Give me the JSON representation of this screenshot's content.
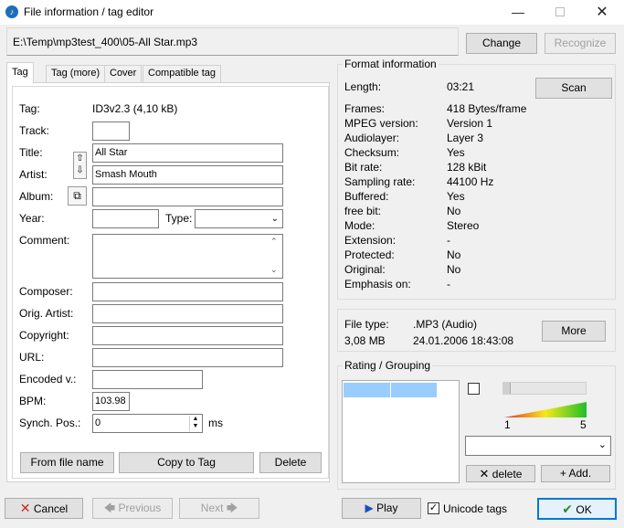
{
  "window": {
    "title": "File information / tag editor",
    "app_icon": "music-note-icon"
  },
  "file_path": "E:\\Temp\\mp3test_400\\05-All Star.mp3",
  "top_buttons": {
    "change": "Change",
    "recognize": "Recognize"
  },
  "tabs": [
    "Tag",
    "Tag (more)",
    "Cover",
    "Compatible tag"
  ],
  "tag": {
    "tag_label": "Tag:",
    "tag_value": "ID3v2.3 (4,10 kB)",
    "track_label": "Track:",
    "track_value": "",
    "title_label": "Title:",
    "title_value": "All Star",
    "artist_label": "Artist:",
    "artist_value": "Smash Mouth",
    "album_label": "Album:",
    "album_value": "",
    "year_label": "Year:",
    "year_value": "",
    "type_label": "Type:",
    "type_value": "",
    "comment_label": "Comment:",
    "comment_value": "",
    "composer_label": "Composer:",
    "orig_artist_label": "Orig. Artist:",
    "copyright_label": "Copyright:",
    "url_label": "URL:",
    "encoded_label": "Encoded v.:",
    "bpm_label": "BPM:",
    "bpm_value": "103.98",
    "synch_label": "Synch. Pos.:",
    "synch_value": "0",
    "synch_unit": "ms"
  },
  "tag_buttons": {
    "from_file_name": "From file name",
    "copy_to_tag": "Copy to Tag",
    "delete": "Delete"
  },
  "format": {
    "group_title": "Format information",
    "scan_button": "Scan",
    "rows": [
      {
        "label": "Length:",
        "value": "03:21"
      },
      {
        "label": "Frames:",
        "value": "418 Bytes/frame"
      },
      {
        "label": "MPEG version:",
        "value": "Version 1"
      },
      {
        "label": "Audiolayer:",
        "value": "Layer 3"
      },
      {
        "label": "Checksum:",
        "value": "Yes"
      },
      {
        "label": "Bit rate:",
        "value": "128 kBit"
      },
      {
        "label": "Sampling rate:",
        "value": "44100 Hz"
      },
      {
        "label": "Buffered:",
        "value": "Yes"
      },
      {
        "label": "free bit:",
        "value": "No"
      },
      {
        "label": "Mode:",
        "value": "Stereo"
      },
      {
        "label": "Extension:",
        "value": "-"
      },
      {
        "label": "Protected:",
        "value": "No"
      },
      {
        "label": "Original:",
        "value": "No"
      },
      {
        "label": "Emphasis on:",
        "value": "-"
      }
    ]
  },
  "fileinfo": {
    "type_label": "File type:",
    "type_value": ".MP3 (Audio)",
    "size": "3,08 MB",
    "date": "24.01.2006 18:43:08",
    "more_button": "More"
  },
  "rating": {
    "group_title": "Rating / Grouping",
    "scale_min": "1",
    "scale_max": "5",
    "delete_button": "delete",
    "add_button": "Add."
  },
  "bottom": {
    "cancel": "Cancel",
    "previous": "Previous",
    "next": "Next",
    "play": "Play",
    "unicode_tags": "Unicode tags",
    "unicode_checked": true,
    "ok": "OK"
  },
  "colors": {
    "accent": "#0078d7",
    "cancel_x": "#c42b1c",
    "ok_check": "#2e8b2e",
    "play": "#1a4fbf"
  }
}
